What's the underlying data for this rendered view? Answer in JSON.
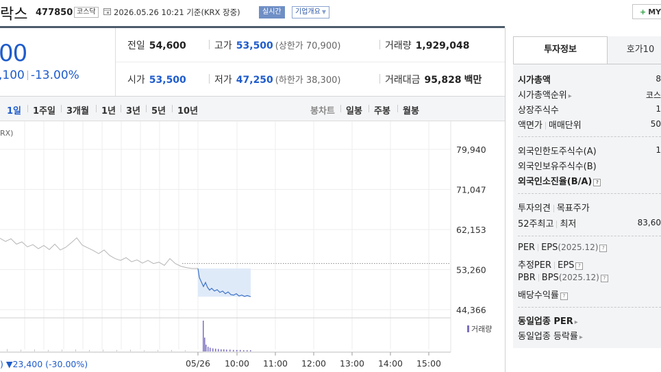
{
  "header": {
    "name": "락스",
    "code": "477850",
    "market": "코스닥",
    "datetime": "2026.05.26 10:21",
    "basis": "기준(KRX 장중)",
    "realtime": "실시간",
    "overview": "기업개요",
    "my": "MY"
  },
  "price": {
    "current": "00",
    "change": ",100",
    "rate": "-13.00%"
  },
  "quote": {
    "prev_label": "전일",
    "prev": "54,600",
    "high_label": "고가",
    "high": "53,500",
    "upper_limit": "(상한가 70,900)",
    "volume_label": "거래량",
    "volume": "1,929,048",
    "open_label": "시가",
    "open": "53,500",
    "low_label": "저가",
    "low": "47,250",
    "lower_limit": "(하한가 38,300)",
    "amount_label": "거래대금",
    "amount": "95,828",
    "amount_unit": "백만"
  },
  "periods": [
    "1일",
    "1주일",
    "3개월",
    "1년",
    "3년",
    "5년",
    "10년"
  ],
  "chart_types": [
    "봉차트",
    "일봉",
    "주봉",
    "월봉"
  ],
  "chart_indicator": "RX)",
  "volume_legend": "거래량",
  "bottom_change": ") ▼23,400 (-30.00%)",
  "chart_data": {
    "type": "line",
    "y_ticks": [
      "79,940",
      "71,047",
      "62,153",
      "53,260",
      "44,366"
    ],
    "x_ticks": [
      "05/26",
      "10:00",
      "11:00",
      "12:00",
      "13:00",
      "14:00",
      "15:00"
    ],
    "ylim": [
      44366,
      79940
    ],
    "reference_price": 54600,
    "history_series": [
      {
        "x": 0,
        "y": 60200
      },
      {
        "x": 8,
        "y": 59500
      },
      {
        "x": 16,
        "y": 60100
      },
      {
        "x": 24,
        "y": 58900
      },
      {
        "x": 32,
        "y": 59400
      },
      {
        "x": 40,
        "y": 58300
      },
      {
        "x": 48,
        "y": 58800
      },
      {
        "x": 56,
        "y": 57900
      },
      {
        "x": 64,
        "y": 58600
      },
      {
        "x": 72,
        "y": 57700
      },
      {
        "x": 80,
        "y": 58900
      },
      {
        "x": 88,
        "y": 57600
      },
      {
        "x": 96,
        "y": 58200
      },
      {
        "x": 104,
        "y": 59200
      },
      {
        "x": 112,
        "y": 60300
      },
      {
        "x": 120,
        "y": 58700
      },
      {
        "x": 128,
        "y": 58100
      },
      {
        "x": 136,
        "y": 57500
      },
      {
        "x": 144,
        "y": 56800
      },
      {
        "x": 152,
        "y": 57600
      },
      {
        "x": 160,
        "y": 56400
      },
      {
        "x": 168,
        "y": 55700
      },
      {
        "x": 176,
        "y": 55300
      },
      {
        "x": 184,
        "y": 55900
      },
      {
        "x": 192,
        "y": 55000
      },
      {
        "x": 200,
        "y": 55400
      },
      {
        "x": 208,
        "y": 54700
      },
      {
        "x": 216,
        "y": 55300
      },
      {
        "x": 224,
        "y": 54600
      },
      {
        "x": 232,
        "y": 54900
      },
      {
        "x": 240,
        "y": 54200
      },
      {
        "x": 248,
        "y": 55700
      },
      {
        "x": 256,
        "y": 54600
      },
      {
        "x": 264,
        "y": 54000
      },
      {
        "x": 272,
        "y": 53700
      },
      {
        "x": 280,
        "y": 53500
      },
      {
        "x": 289,
        "y": 53500
      }
    ],
    "intraday_series": [
      {
        "x": 289,
        "y": 53500
      },
      {
        "x": 291,
        "y": 51500
      },
      {
        "x": 294,
        "y": 50500
      },
      {
        "x": 297,
        "y": 49500
      },
      {
        "x": 300,
        "y": 50400
      },
      {
        "x": 303,
        "y": 49300
      },
      {
        "x": 306,
        "y": 48700
      },
      {
        "x": 309,
        "y": 49100
      },
      {
        "x": 313,
        "y": 48500
      },
      {
        "x": 317,
        "y": 48800
      },
      {
        "x": 321,
        "y": 48200
      },
      {
        "x": 325,
        "y": 48500
      },
      {
        "x": 329,
        "y": 47900
      },
      {
        "x": 333,
        "y": 48300
      },
      {
        "x": 337,
        "y": 47700
      },
      {
        "x": 341,
        "y": 47600
      },
      {
        "x": 345,
        "y": 47900
      },
      {
        "x": 349,
        "y": 47400
      },
      {
        "x": 353,
        "y": 47600
      },
      {
        "x": 357,
        "y": 47300
      },
      {
        "x": 361,
        "y": 47500
      },
      {
        "x": 366,
        "y": 47250
      }
    ],
    "volume": [
      {
        "x": 296,
        "v": 1.0
      },
      {
        "x": 298,
        "v": 0.45
      },
      {
        "x": 300,
        "v": 0.22
      },
      {
        "x": 303,
        "v": 0.15
      },
      {
        "x": 306,
        "v": 0.12
      },
      {
        "x": 310,
        "v": 0.1
      },
      {
        "x": 314,
        "v": 0.09
      },
      {
        "x": 318,
        "v": 0.08
      },
      {
        "x": 322,
        "v": 0.07
      },
      {
        "x": 326,
        "v": 0.07
      },
      {
        "x": 330,
        "v": 0.06
      },
      {
        "x": 335,
        "v": 0.06
      },
      {
        "x": 340,
        "v": 0.05
      },
      {
        "x": 345,
        "v": 0.05
      },
      {
        "x": 350,
        "v": 0.05
      },
      {
        "x": 355,
        "v": 0.04
      },
      {
        "x": 360,
        "v": 0.04
      },
      {
        "x": 365,
        "v": 0.04
      }
    ],
    "history_volume": [
      {
        "x": 10,
        "v": 0.08
      },
      {
        "x": 30,
        "v": 0.06
      },
      {
        "x": 50,
        "v": 0.07
      },
      {
        "x": 70,
        "v": 0.05
      },
      {
        "x": 90,
        "v": 0.06
      },
      {
        "x": 110,
        "v": 0.07
      },
      {
        "x": 130,
        "v": 0.05
      },
      {
        "x": 150,
        "v": 0.06
      },
      {
        "x": 170,
        "v": 0.05
      },
      {
        "x": 190,
        "v": 0.06
      },
      {
        "x": 210,
        "v": 0.04
      },
      {
        "x": 230,
        "v": 0.05
      },
      {
        "x": 250,
        "v": 0.05
      },
      {
        "x": 270,
        "v": 0.04
      }
    ],
    "colors": {
      "history": "#b5b5b5",
      "intraday": "#3d72c7",
      "area": "#dbe8f8",
      "reference": "#888888",
      "volume": "#7a6fc0"
    }
  },
  "panel": {
    "tabs": [
      "투자정보",
      "호가10"
    ],
    "rows": [
      {
        "label": "시가총액",
        "value": "8",
        "bold": true
      },
      {
        "label": "시가총액순위",
        "value": "코스",
        "chev": true
      },
      {
        "label": "상장주식수",
        "value": "1"
      },
      {
        "label": "액면가",
        "label2": "매매단위",
        "value": "50"
      }
    ],
    "foreign": [
      {
        "label": "외국인한도주식수(A)",
        "value": "1"
      },
      {
        "label": "외국인보유주식수(B)",
        "value": ""
      },
      {
        "label": "외국인소진율(B/A)",
        "value": "",
        "bold": true,
        "q": true
      }
    ],
    "opinion": [
      {
        "label": "투자의견",
        "label2": "목표주가",
        "value": ""
      },
      {
        "label": "52주최고",
        "label2": "최저",
        "value": "83,60"
      }
    ],
    "valuation": [
      {
        "label": "PER",
        "label2": "EPS",
        "note": "(2025.12)",
        "q": true
      },
      {
        "label": "추정PER",
        "label2": "EPS",
        "q": true
      },
      {
        "label": "PBR",
        "label2": "BPS",
        "note": "(2025.12)",
        "q": true
      },
      {
        "label": "배당수익률",
        "q": true
      }
    ],
    "industry": [
      {
        "label": "동일업종 PER",
        "bold": true,
        "chev": true
      },
      {
        "label": "동일업종 등락률",
        "chev": true
      }
    ]
  }
}
